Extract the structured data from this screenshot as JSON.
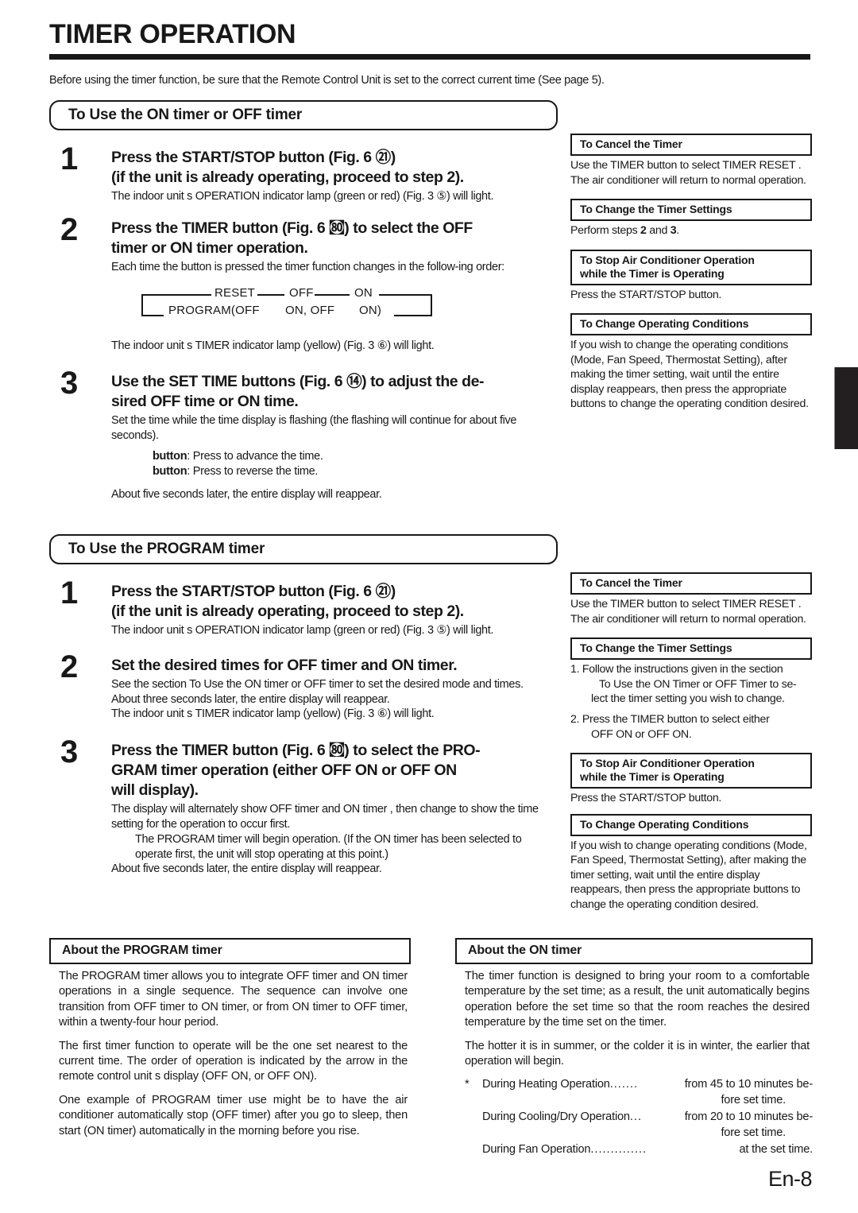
{
  "page": {
    "title": "TIMER OPERATION",
    "intro": "Before using the timer function, be sure that the Remote Control Unit is set to the correct current time (See page 5).",
    "page_number": "En-8"
  },
  "section_on_off": {
    "header": "To Use the ON timer or OFF timer",
    "steps": [
      {
        "num": "1",
        "title_line1": "Press the START/STOP button (Fig. 6 ㉑)",
        "title_line2": "(if the unit is already operating, proceed to step 2).",
        "body": "The indoor unit s OPERATION indicator lamp (green or red) (Fig. 3 ⑤) will light."
      },
      {
        "num": "2",
        "title_line1": "Press the TIMER button (Fig. 6 ㉏) to select the OFF",
        "title_line2": "timer or ON timer operation.",
        "body": "Each time the button is pressed the timer function changes in the follow-ing order:",
        "after_diagram": "The indoor unit s TIMER indicator lamp (yellow) (Fig. 3 ⑥) will light."
      },
      {
        "num": "3",
        "title_line1": "Use the SET TIME buttons (Fig. 6 ⑭) to adjust the de-",
        "title_line2": "sired OFF time or ON time.",
        "body": "Set the time while the time display is flashing (the flashing will continue for about five seconds).",
        "btn_up_label": "button",
        "btn_up_text": "Press to advance the time.",
        "btn_down_label": "button",
        "btn_down_text": "Press to reverse the time.",
        "closing": "About five seconds later, the entire display will reappear."
      }
    ]
  },
  "cycle_diagram": {
    "top": [
      "RESET",
      "OFF",
      "ON"
    ],
    "bottom": [
      "PROGRAM(OFF",
      "ON, OFF",
      "ON)"
    ]
  },
  "section_program": {
    "header": "To Use the PROGRAM timer",
    "steps": [
      {
        "num": "1",
        "title_line1": "Press the START/STOP button (Fig. 6 ㉑)",
        "title_line2": "(if the unit is already operating, proceed to step 2).",
        "body": "The indoor unit s OPERATION indicator lamp (green or red) (Fig. 3 ⑤) will light."
      },
      {
        "num": "2",
        "title_line1": "Set the desired times for OFF timer and ON timer.",
        "body_1": "See the section  To Use the ON timer or OFF timer  to set the desired mode and times.",
        "body_2": "About three seconds later, the entire display will reappear.",
        "body_3": "The indoor unit s TIMER indicator lamp (yellow) (Fig. 3 ⑥) will light."
      },
      {
        "num": "3",
        "title_line1": "Press the TIMER button (Fig. 6 ㉏) to select the PRO-",
        "title_line2": "GRAM timer operation (either OFF     ON or OFF     ON",
        "title_line3": "will display).",
        "body_1": "The display will alternately show  OFF timer  and  ON timer , then change to show the time setting for the operation to occur first.",
        "body_2": "The PROGRAM timer will begin operation. (If the ON timer has been selected to operate first, the unit will stop operating at this point.)",
        "body_3": "About five seconds later, the entire display will reappear."
      }
    ]
  },
  "tips_on_off": [
    {
      "head": "To Cancel the Timer",
      "lines": [
        "Use the TIMER button to select  TIMER RESET .",
        "The air conditioner will return to normal operation."
      ]
    },
    {
      "head": "To Change the Timer Settings",
      "perform_prefix": "Perform steps ",
      "perform_b1": "2",
      "perform_mid": " and ",
      "perform_b2": "3",
      "perform_suffix": "."
    },
    {
      "head_line1": "To Stop Air Conditioner Operation",
      "head_line2": "while the Timer is Operating",
      "lines": [
        "Press the START/STOP button."
      ]
    },
    {
      "head": "To Change Operating Conditions",
      "lines": [
        "If you wish to change the operating conditions (Mode, Fan Speed, Thermostat Setting), after making the timer setting, wait until the entire display reappears, then press the appropriate buttons to change the operating condition desired."
      ]
    }
  ],
  "tips_program": [
    {
      "head": "To Cancel the Timer",
      "lines": [
        "Use the TIMER button to select  TIMER RESET .",
        "The air conditioner will return to normal operation."
      ]
    },
    {
      "head": "To Change the Timer Settings",
      "item1_num": "1.",
      "item1_line1": "Follow the instructions given in the section",
      "item1_line2": "To Use the ON Timer or OFF Timer  to se-",
      "item1_line3": "lect the timer setting you wish to change.",
      "item2_num": "2.",
      "item2_line1": "Press the TIMER button to select either",
      "item2_line2": "OFF     ON or OFF     ON."
    },
    {
      "head_line1": "To Stop Air Conditioner Operation",
      "head_line2": "while the Timer is Operating",
      "lines": [
        "Press the START/STOP button."
      ]
    },
    {
      "head": "To Change Operating Conditions",
      "lines": [
        "If you wish to change operating conditions (Mode, Fan Speed, Thermostat Setting), after making the timer setting, wait until the entire display reappears, then press the appropriate buttons to change the operating condition desired."
      ]
    }
  ],
  "about_program": {
    "head": "About the PROGRAM timer",
    "p1": "The PROGRAM timer allows you to integrate OFF timer and ON timer operations in a single sequence. The sequence can involve one transition from OFF timer to ON timer, or from ON timer to OFF timer, within a twenty-four hour period.",
    "p2": "The first timer function to operate will be the one set nearest to the current time. The order of operation is indicated by the arrow in the remote control unit s display (OFF     ON, or OFF     ON).",
    "p3": "One example of PROGRAM timer use might be to have the air conditioner automatically stop (OFF timer) after you go to sleep, then start (ON timer) automatically in the morning before you rise."
  },
  "about_on": {
    "head": "About the ON timer",
    "p1": "The timer function is designed to bring your room to a comfortable temperature by the set time; as a result, the unit automatically begins operation before the set time so that the room reaches the desired temperature by the time set on the timer.",
    "p2": "The hotter it is in summer, or the colder it is in winter, the earlier that operation will begin.",
    "star": "*",
    "rows": [
      {
        "label": "During Heating Operation",
        "dots": ".......",
        "value": "from 45 to 10 minutes be-",
        "value2": "fore set time."
      },
      {
        "label": "During Cooling/Dry Operation",
        "dots": "...",
        "value": "from 20 to 10 minutes be-",
        "value2": "fore set time."
      },
      {
        "label": "During Fan Operation",
        "dots": "..............",
        "value": "at the set time.",
        "value2": ""
      }
    ]
  }
}
